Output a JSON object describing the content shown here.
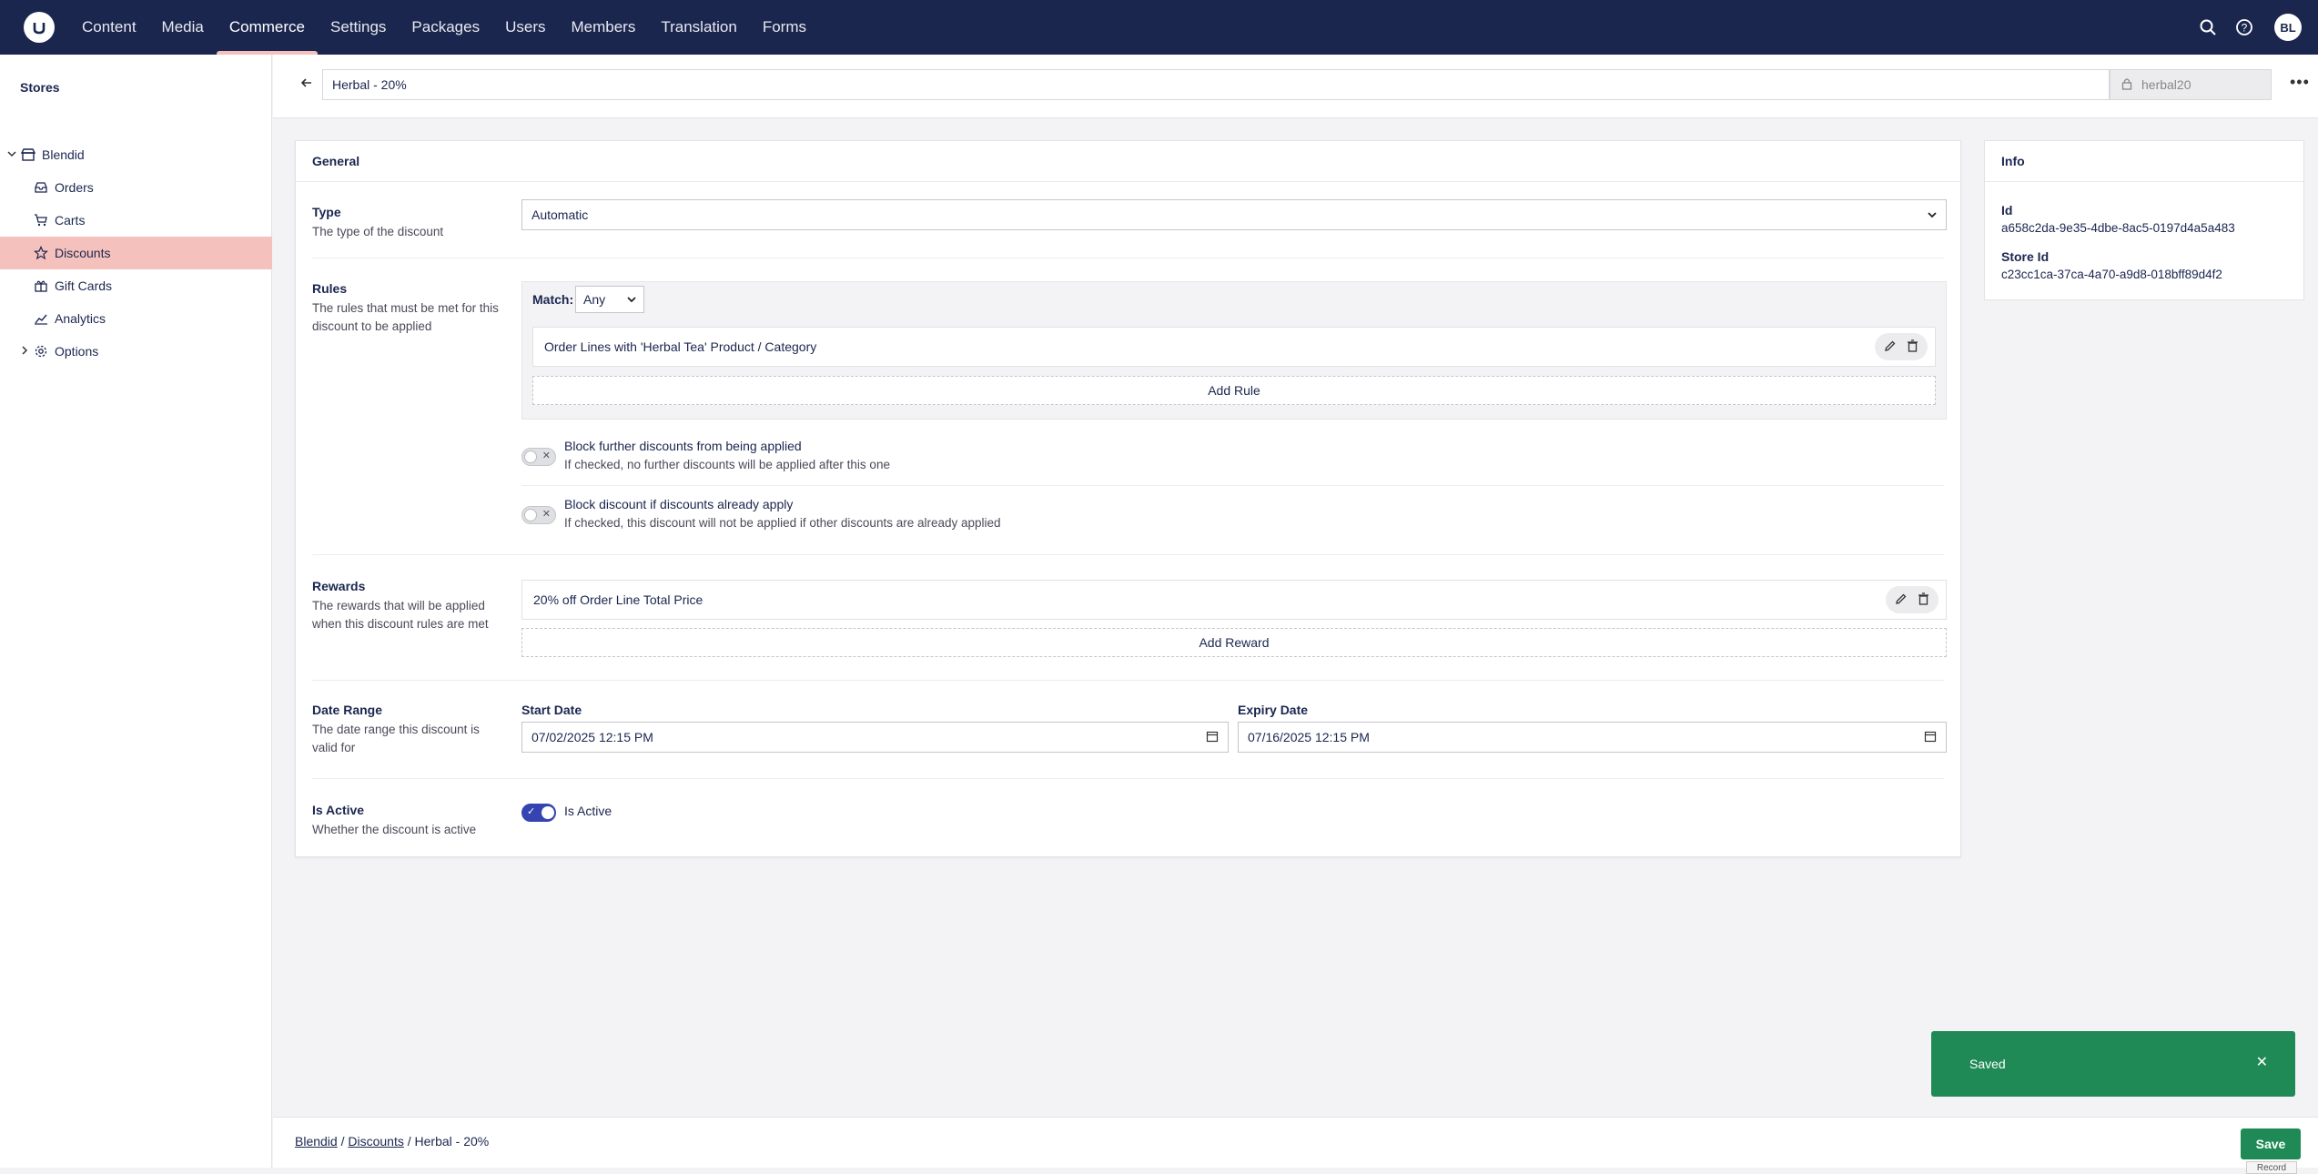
{
  "nav": {
    "items": [
      "Content",
      "Media",
      "Commerce",
      "Settings",
      "Packages",
      "Users",
      "Members",
      "Translation",
      "Forms"
    ],
    "active_index": 2,
    "avatar_initials": "BL"
  },
  "sidebar": {
    "title": "Stores",
    "store": "Blendid",
    "items": [
      {
        "label": "Orders",
        "icon": "inbox-icon"
      },
      {
        "label": "Carts",
        "icon": "cart-icon"
      },
      {
        "label": "Discounts",
        "icon": "star-icon",
        "active": true
      },
      {
        "label": "Gift Cards",
        "icon": "gift-icon"
      },
      {
        "label": "Analytics",
        "icon": "chart-icon"
      }
    ],
    "options": "Options"
  },
  "header": {
    "name": "Herbal - 20%",
    "alias": "herbal20"
  },
  "general": {
    "title": "General",
    "type_label": "Type",
    "type_desc": "The type of the discount",
    "type_value": "Automatic",
    "rules_label": "Rules",
    "rules_desc": "The rules that must be met for this discount to be applied",
    "match_label": "Match:",
    "match_value": "Any",
    "rule_item": "Order Lines with 'Herbal Tea' Product / Category",
    "add_rule": "Add Rule",
    "block_further_title": "Block further discounts from being applied",
    "block_further_desc": "If checked, no further discounts will be applied after this one",
    "block_if_title": "Block discount if discounts already apply",
    "block_if_desc": "If checked, this discount will not be applied if other discounts are already applied",
    "rewards_label": "Rewards",
    "rewards_desc": "The rewards that will be applied when this discount rules are met",
    "reward_item": "20% off Order Line Total Price",
    "add_reward": "Add Reward",
    "date_label": "Date Range",
    "date_desc": "The date range this discount is valid for",
    "start_label": "Start Date",
    "start_value": "07/02/2025 12:15 PM",
    "expiry_label": "Expiry Date",
    "expiry_value": "07/16/2025 12:15 PM",
    "active_label": "Is Active",
    "active_desc": "Whether the discount is active",
    "active_toggle_label": "Is Active",
    "is_active": true
  },
  "info": {
    "title": "Info",
    "id_label": "Id",
    "id_value": "a658c2da-9e35-4dbe-8ac5-0197d4a5a483",
    "store_id_label": "Store Id",
    "store_id_value": "c23cc1ca-37ca-4a70-a9d8-018bff89d4f2"
  },
  "toast": {
    "message": "Saved"
  },
  "footer": {
    "crumb_1": "Blendid",
    "crumb_2": "Discounts",
    "crumb_3": "Herbal - 20%",
    "save": "Save",
    "tooltip": "Record"
  },
  "colors": {
    "topbar": "#1b264f",
    "active_nav": "#f5c1bc",
    "save": "#1f8a56",
    "toggle_on": "#3544b1"
  }
}
